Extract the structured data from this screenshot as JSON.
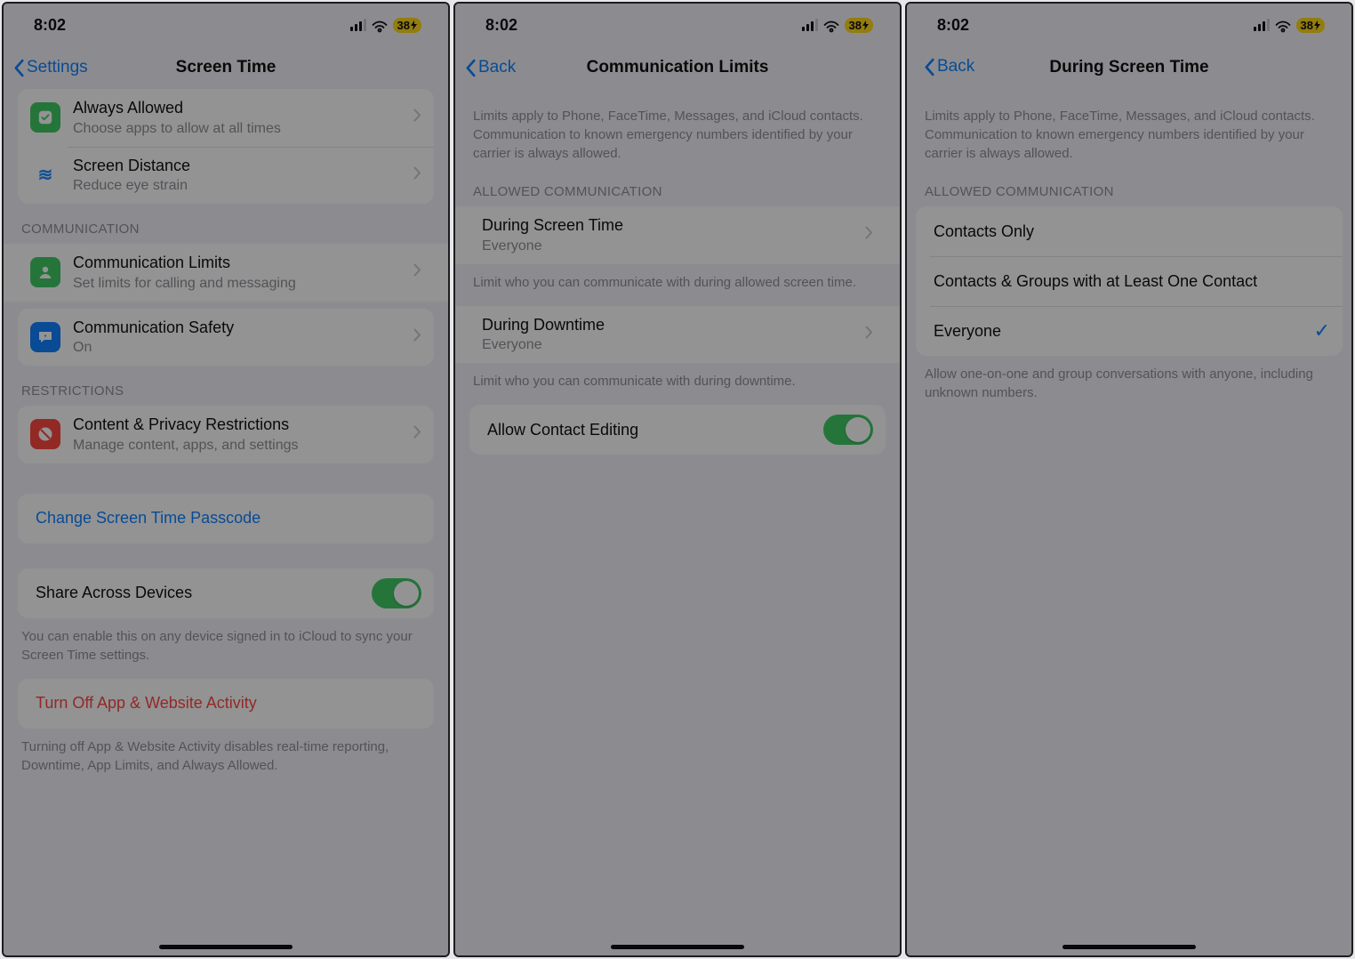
{
  "status": {
    "time": "8:02",
    "battery": "38"
  },
  "screen1": {
    "back": "Settings",
    "title": "Screen Time",
    "rows": {
      "always_allowed": {
        "title": "Always Allowed",
        "sub": "Choose apps to allow at all times"
      },
      "screen_distance": {
        "title": "Screen Distance",
        "sub": "Reduce eye strain"
      },
      "comm_header": "COMMUNICATION",
      "comm_limits": {
        "title": "Communication Limits",
        "sub": "Set limits for calling and messaging"
      },
      "comm_safety": {
        "title": "Communication Safety",
        "sub": "On"
      },
      "restrictions_header": "RESTRICTIONS",
      "content_privacy": {
        "title": "Content & Privacy Restrictions",
        "sub": "Manage content, apps, and settings"
      },
      "change_passcode": "Change Screen Time Passcode",
      "share_devices": "Share Across Devices",
      "share_info": "You can enable this on any device signed in to iCloud to sync your Screen Time settings.",
      "turn_off": "Turn Off App & Website Activity",
      "turn_off_info": "Turning off App & Website Activity disables real-time reporting, Downtime, App Limits, and Always Allowed."
    }
  },
  "screen2": {
    "back": "Back",
    "title": "Communication Limits",
    "info": "Limits apply to Phone, FaceTime, Messages, and iCloud contacts. Communication to known emergency numbers identified by your carrier is always allowed.",
    "header": "ALLOWED COMMUNICATION",
    "during_screen_time": {
      "title": "During Screen Time",
      "sub": "Everyone"
    },
    "dst_info": "Limit who you can communicate with during allowed screen time.",
    "during_downtime": {
      "title": "During Downtime",
      "sub": "Everyone"
    },
    "dd_info": "Limit who you can communicate with during downtime.",
    "allow_contact_editing": "Allow Contact Editing"
  },
  "screen3": {
    "back": "Back",
    "title": "During Screen Time",
    "info": "Limits apply to Phone, FaceTime, Messages, and iCloud contacts. Communication to known emergency numbers identified by your carrier is always allowed.",
    "header": "ALLOWED COMMUNICATION",
    "options": {
      "contacts_only": "Contacts Only",
      "groups": "Contacts & Groups with at Least One Contact",
      "everyone": "Everyone"
    },
    "everyone_info": "Allow one-on-one and group conversations with anyone, including unknown numbers."
  }
}
